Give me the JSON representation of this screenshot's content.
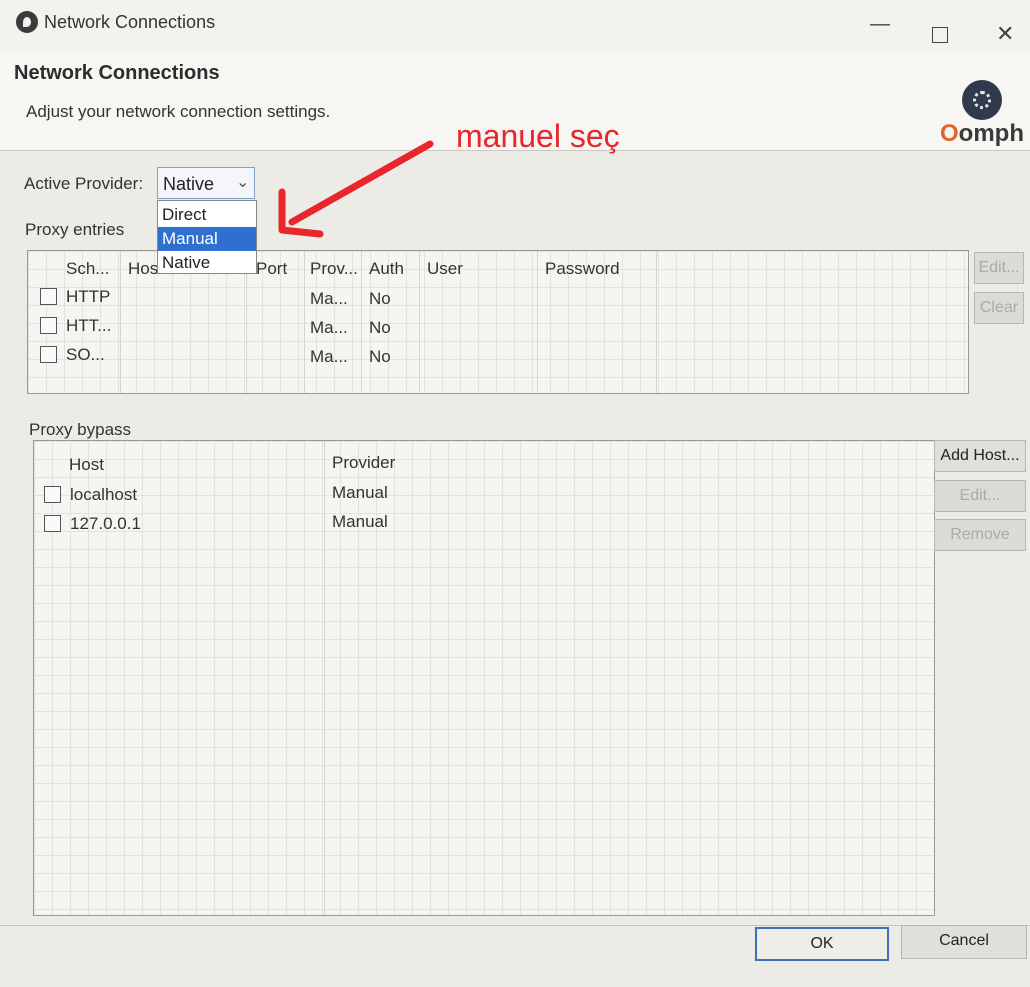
{
  "window": {
    "title": "Network Connections"
  },
  "header": {
    "title": "Network Connections",
    "description": "Adjust your network connection settings.",
    "logo_text": "Oomph"
  },
  "annotation": {
    "text": "manuel seç",
    "color": "#e8262c"
  },
  "provider": {
    "label": "Active Provider:",
    "selected": "Native",
    "options": [
      "Direct",
      "Manual",
      "Native"
    ],
    "highlighted": "Manual"
  },
  "proxy_entries": {
    "label": "Proxy entries",
    "columns": [
      "Sch...",
      "Host",
      "Port",
      "Prov...",
      "Auth",
      "User",
      "Password"
    ],
    "rows": [
      {
        "scheme": "HTTP",
        "provider": "Ma...",
        "auth": "No"
      },
      {
        "scheme": "HTT...",
        "provider": "Ma...",
        "auth": "No"
      },
      {
        "scheme": "SO...",
        "provider": "Ma...",
        "auth": "No"
      }
    ],
    "buttons": {
      "edit": "Edit...",
      "clear": "Clear"
    }
  },
  "proxy_bypass": {
    "label": "Proxy bypass",
    "columns": [
      "Host",
      "Provider"
    ],
    "rows": [
      {
        "host": "localhost",
        "provider": "Manual"
      },
      {
        "host": "127.0.0.1",
        "provider": "Manual"
      }
    ],
    "buttons": {
      "add": "Add Host...",
      "edit": "Edit...",
      "remove": "Remove"
    }
  },
  "footer": {
    "ok": "OK",
    "cancel": "Cancel"
  },
  "colors": {
    "accent": "#2f6fcf",
    "annotation": "#e8262c"
  }
}
